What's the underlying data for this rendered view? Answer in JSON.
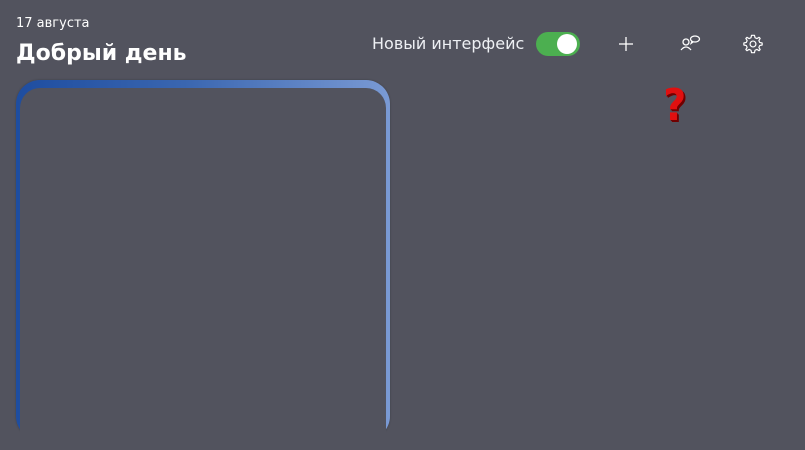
{
  "header": {
    "date": "17 августа",
    "greeting": "Добрый день"
  },
  "toolbar": {
    "new_ui_label": "Новый интерфейс",
    "new_ui_enabled": true,
    "add_icon": "plus-icon",
    "feedback_icon": "feedback-icon",
    "settings_icon": "gear-icon"
  },
  "annotation": {
    "mark": "?"
  },
  "colors": {
    "background": "#52535e",
    "toggle_on": "#4caf50",
    "card_gradient_start": "#1e4da0",
    "card_gradient_end": "#7a9ad4",
    "annotation": "#e01010"
  }
}
